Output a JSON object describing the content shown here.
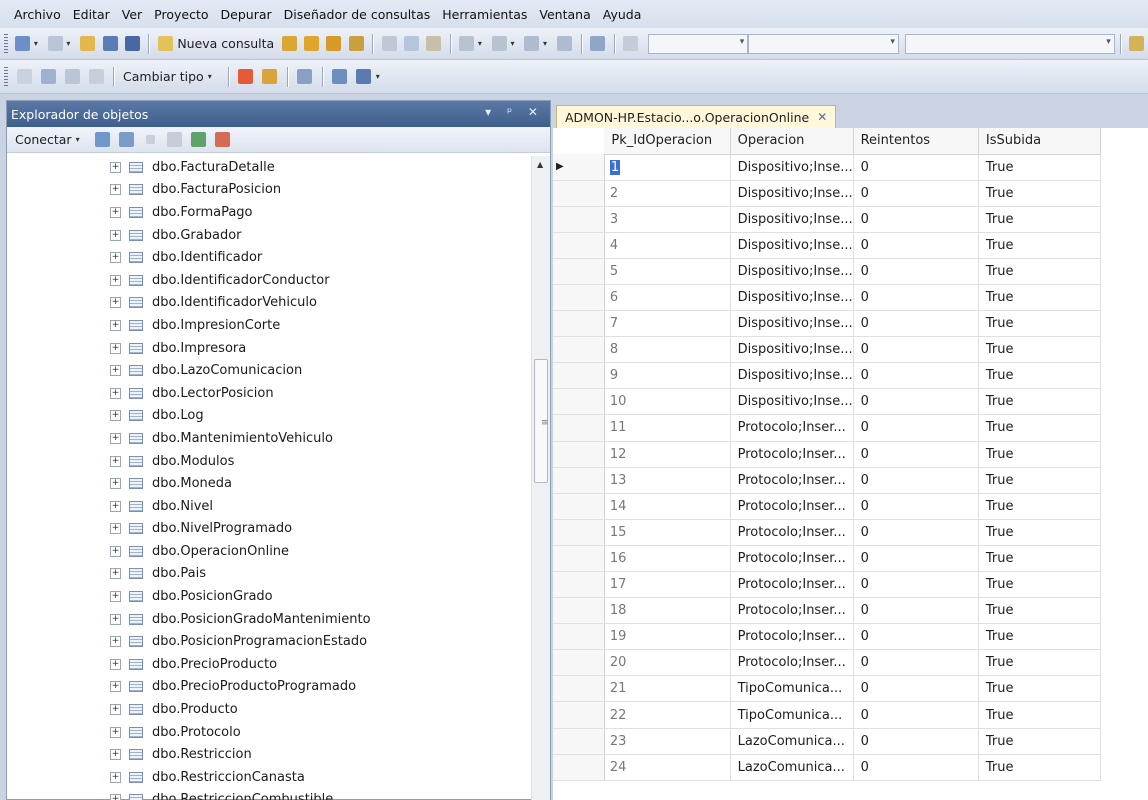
{
  "menu": [
    "Archivo",
    "Editar",
    "Ver",
    "Proyecto",
    "Depurar",
    "Diseñador de consultas",
    "Herramientas",
    "Ventana",
    "Ayuda"
  ],
  "toolbar1": {
    "new_query_label": "Nueva consulta"
  },
  "toolbar2": {
    "change_type_label": "Cambiar tipo"
  },
  "explorer": {
    "title": "Explorador de objetos",
    "controls": "▾ ᵖ ✕",
    "connect_label": "Conectar",
    "items": [
      "dbo.FacturaDetalle",
      "dbo.FacturaPosicion",
      "dbo.FormaPago",
      "dbo.Grabador",
      "dbo.Identificador",
      "dbo.IdentificadorConductor",
      "dbo.IdentificadorVehiculo",
      "dbo.ImpresionCorte",
      "dbo.Impresora",
      "dbo.LazoComunicacion",
      "dbo.LectorPosicion",
      "dbo.Log",
      "dbo.MantenimientoVehiculo",
      "dbo.Modulos",
      "dbo.Moneda",
      "dbo.Nivel",
      "dbo.NivelProgramado",
      "dbo.OperacionOnline",
      "dbo.Pais",
      "dbo.PosicionGrado",
      "dbo.PosicionGradoMantenimiento",
      "dbo.PosicionProgramacionEstado",
      "dbo.PrecioProducto",
      "dbo.PrecioProductoProgramado",
      "dbo.Producto",
      "dbo.Protocolo",
      "dbo.Restriccion",
      "dbo.RestriccionCanasta",
      "dbo.RestriccionCombustible"
    ]
  },
  "document": {
    "tab_title": "ADMON-HP.Estacio...o.OperacionOnline",
    "columns": [
      "Pk_IdOperacion",
      "Operacion",
      "Reintentos",
      "IsSubida"
    ],
    "rows": [
      [
        "1",
        "Dispositivo;Inse...",
        "0",
        "True"
      ],
      [
        "2",
        "Dispositivo;Inse...",
        "0",
        "True"
      ],
      [
        "3",
        "Dispositivo;Inse...",
        "0",
        "True"
      ],
      [
        "4",
        "Dispositivo;Inse...",
        "0",
        "True"
      ],
      [
        "5",
        "Dispositivo;Inse...",
        "0",
        "True"
      ],
      [
        "6",
        "Dispositivo;Inse...",
        "0",
        "True"
      ],
      [
        "7",
        "Dispositivo;Inse...",
        "0",
        "True"
      ],
      [
        "8",
        "Dispositivo;Inse...",
        "0",
        "True"
      ],
      [
        "9",
        "Dispositivo;Inse...",
        "0",
        "True"
      ],
      [
        "10",
        "Dispositivo;Inse...",
        "0",
        "True"
      ],
      [
        "11",
        "Protocolo;Inser...",
        "0",
        "True"
      ],
      [
        "12",
        "Protocolo;Inser...",
        "0",
        "True"
      ],
      [
        "13",
        "Protocolo;Inser...",
        "0",
        "True"
      ],
      [
        "14",
        "Protocolo;Inser...",
        "0",
        "True"
      ],
      [
        "15",
        "Protocolo;Inser...",
        "0",
        "True"
      ],
      [
        "16",
        "Protocolo;Inser...",
        "0",
        "True"
      ],
      [
        "17",
        "Protocolo;Inser...",
        "0",
        "True"
      ],
      [
        "18",
        "Protocolo;Inser...",
        "0",
        "True"
      ],
      [
        "19",
        "Protocolo;Inser...",
        "0",
        "True"
      ],
      [
        "20",
        "Protocolo;Inser...",
        "0",
        "True"
      ],
      [
        "21",
        "TipoComunica...",
        "0",
        "True"
      ],
      [
        "22",
        "TipoComunica...",
        "0",
        "True"
      ],
      [
        "23",
        "LazoComunica...",
        "0",
        "True"
      ],
      [
        "24",
        "LazoComunica...",
        "0",
        "True"
      ]
    ],
    "selected_row": 0
  },
  "colors": {
    "accent": "#3e5e8d",
    "tab_active": "#fff7d9",
    "selection": "#3a6fd8"
  }
}
